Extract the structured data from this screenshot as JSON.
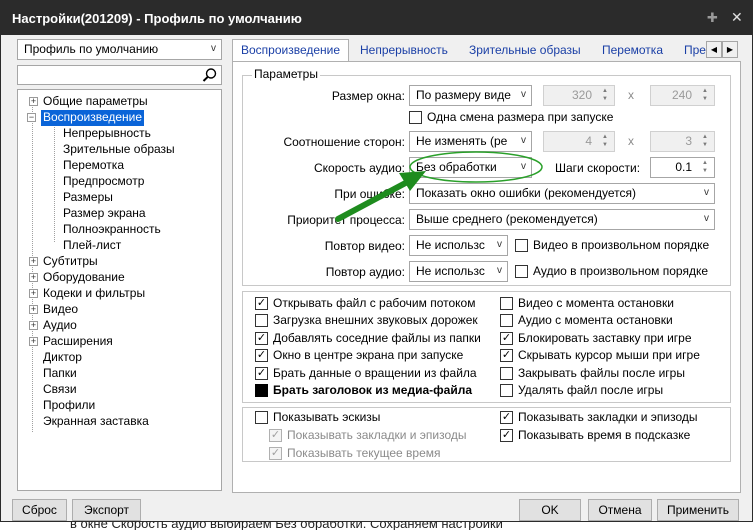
{
  "window": {
    "title": "Настройки(201209) - Профиль по умолчанию"
  },
  "profile": {
    "selected": "Профиль по умолчанию"
  },
  "search": {
    "value": ""
  },
  "tree": [
    {
      "label": "Общие параметры",
      "expander": "+"
    },
    {
      "label": "Воспроизведение",
      "expander": "−",
      "selected": true
    },
    {
      "label": "Непрерывность"
    },
    {
      "label": "Зрительные образы"
    },
    {
      "label": "Перемотка"
    },
    {
      "label": "Предпросмотр"
    },
    {
      "label": "Размеры"
    },
    {
      "label": "Размер экрана"
    },
    {
      "label": "Полноэкранность"
    },
    {
      "label": "Плей-лист"
    },
    {
      "label": "Субтитры",
      "expander": "+"
    },
    {
      "label": "Оборудование",
      "expander": "+"
    },
    {
      "label": "Кодеки и фильтры",
      "expander": "+"
    },
    {
      "label": "Видео",
      "expander": "+"
    },
    {
      "label": "Аудио",
      "expander": "+"
    },
    {
      "label": "Расширения",
      "expander": "+"
    },
    {
      "label": "Диктор"
    },
    {
      "label": "Папки"
    },
    {
      "label": "Связи"
    },
    {
      "label": "Профили"
    },
    {
      "label": "Экранная заставка"
    }
  ],
  "tabs": [
    "Воспроизведение",
    "Непрерывность",
    "Зрительные образы",
    "Перемотка",
    "Пре"
  ],
  "params": {
    "group_title": "Параметры",
    "window_size_label": "Размер окна:",
    "window_size_value": "По размеру виде",
    "width": "320",
    "height": "240",
    "x1": "x",
    "x2": "x",
    "single_change": "Одна смена размера при запуске",
    "aspect_label": "Соотношение сторон:",
    "aspect_value": "Не изменять (ре",
    "aspect_w": "4",
    "aspect_h": "3",
    "audio_speed_label": "Скорость аудио:",
    "audio_speed_value": "Без обработки",
    "speed_step_label": "Шаги скорости:",
    "speed_step_value": "0.1",
    "on_error_label": "При ошибке:",
    "on_error_value": "Показать окно ошибки (рекомендуется)",
    "priority_label": "Приоритет процесса:",
    "priority_value": "Выше среднего (рекомендуется)",
    "repeat_video_label": "Повтор видео:",
    "repeat_video_value": "Не использс",
    "random_video": "Видео в произвольном порядке",
    "repeat_audio_label": "Повтор аудио:",
    "repeat_audio_value": "Не использс",
    "random_audio": "Аудио в произвольном порядке"
  },
  "options_left": [
    {
      "label": "Открывать файл с рабочим потоком",
      "checked": true
    },
    {
      "label": "Загрузка внешних звуковых дорожек",
      "checked": false
    },
    {
      "label": "Добавлять соседние файлы из папки",
      "checked": true
    },
    {
      "label": "Окно в центре экрана при запуске",
      "checked": true
    },
    {
      "label": "Брать данные о вращении из файла",
      "checked": true
    },
    {
      "label": "Брать заголовок из медиа-файла",
      "checked": true,
      "bold": true
    }
  ],
  "options_right": [
    {
      "label": "Видео с момента остановки",
      "checked": false
    },
    {
      "label": "Аудио с момента остановки",
      "checked": false
    },
    {
      "label": "Блокировать заставку при игре",
      "checked": true
    },
    {
      "label": "Скрывать курсор мыши при игре",
      "checked": true
    },
    {
      "label": "Закрывать файлы после игры",
      "checked": false
    },
    {
      "label": "Удалять файл после игры",
      "checked": false
    }
  ],
  "thumbs": {
    "show_thumbs": "Показывать эскизы",
    "show_bookmarks_chapters": "Показывать закладки и эпизоды",
    "show_current_time": "Показывать текущее время",
    "right_bookmarks": "Показывать закладки и эпизоды",
    "right_time_tooltip": "Показывать время в подсказке"
  },
  "buttons": {
    "reset": "Сброс",
    "export": "Экспорт",
    "ok": "OK",
    "cancel": "Отмена",
    "apply": "Применить"
  },
  "below_window_text": "в окне Скорость аудио выбираем Без обработки. Сохраняем настройки",
  "colors": {
    "titlebar": "#2b2b2b",
    "selection": "#0a64d8",
    "arrow": "#1e8c1e",
    "highlight": "#2aa02a",
    "tab_text": "#1a3fa6"
  },
  "icons": [
    "pin-icon",
    "close-icon",
    "search-icon",
    "arrow-annotation-icon"
  ]
}
